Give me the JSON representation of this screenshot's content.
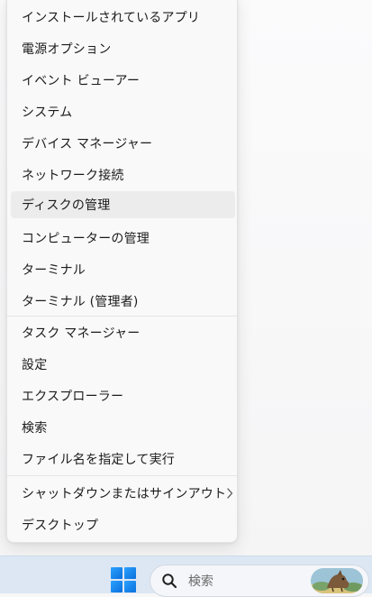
{
  "context_menu": {
    "items": [
      {
        "label": "インストールされているアプリ"
      },
      {
        "label": "電源オプション"
      },
      {
        "label": "イベント ビューアー"
      },
      {
        "label": "システム"
      },
      {
        "label": "デバイス マネージャー"
      },
      {
        "label": "ネットワーク接続"
      },
      {
        "label": "ディスクの管理",
        "hovered": true
      },
      {
        "label": "コンピューターの管理"
      },
      {
        "label": "ターミナル"
      },
      {
        "label": "ターミナル (管理者)"
      },
      {
        "label": "タスク マネージャー"
      },
      {
        "label": "設定"
      },
      {
        "label": "エクスプローラー"
      },
      {
        "label": "検索"
      },
      {
        "label": "ファイル名を指定して実行"
      },
      {
        "label": "シャットダウンまたはサインアウト",
        "has_submenu": true
      },
      {
        "label": "デスクトップ"
      }
    ]
  },
  "taskbar": {
    "start_icon": "windows-logo-icon",
    "search": {
      "placeholder": "検索",
      "icon": "search-icon"
    }
  },
  "colors": {
    "menu_bg": "#f9f9f9",
    "hover_bg": "#ececec",
    "taskbar_bg": "#dde7f4",
    "start_blue": "#0a78e6"
  }
}
